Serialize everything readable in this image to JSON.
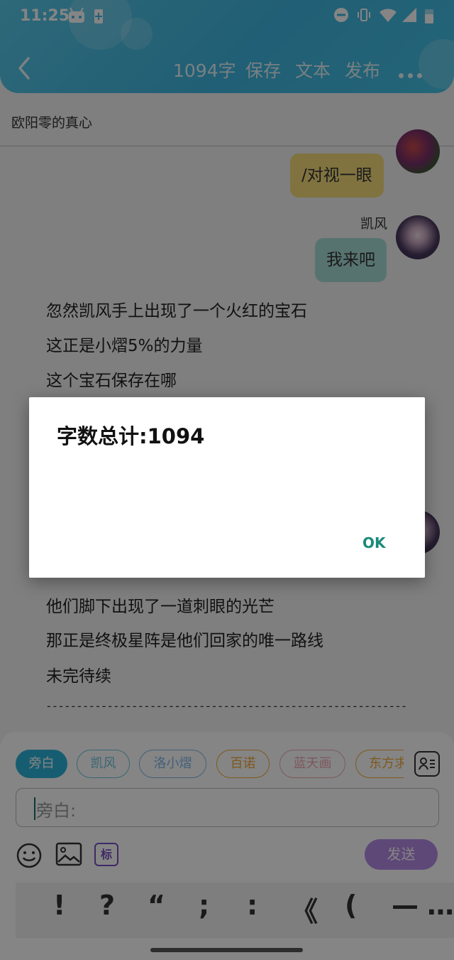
{
  "status_bar": {
    "time": "11:25"
  },
  "header": {
    "word_count": "1094字",
    "save": "保存",
    "text": "文本",
    "publish": "发布"
  },
  "document": {
    "title": "欧阳零的真心"
  },
  "chat": {
    "msg1": "/对视一眼",
    "speaker2": "凯风",
    "msg2": "我来吧",
    "narration_top": [
      "忽然凯风手上出现了一个火红的宝石",
      "这正是小熠5%的力量",
      "这个宝石保存在哪"
    ],
    "narration_bottom": [
      "他们脚下出现了一道刺眼的光芒",
      "那正是终极星阵是他们回家的唯一路线",
      "未完待续"
    ],
    "separator": "---------------------------------------------------------------------"
  },
  "composer": {
    "roles": [
      "旁白",
      "凯风",
      "洛小熠",
      "百诺",
      "蓝天画",
      "东方求"
    ],
    "role_colors": [
      "#2cb3d9",
      "#6cc3dc",
      "#7fb7e8",
      "#f2a93b",
      "#f0a7b5",
      "#f2a93b"
    ],
    "placeholder": "旁白:",
    "tag_label": "标",
    "send": "发送",
    "punctuation": [
      "!",
      "?",
      "“",
      ";",
      ":",
      "《",
      "(",
      "—",
      "…"
    ]
  },
  "dialog": {
    "title": "字数总计:1094",
    "ok": "OK"
  }
}
